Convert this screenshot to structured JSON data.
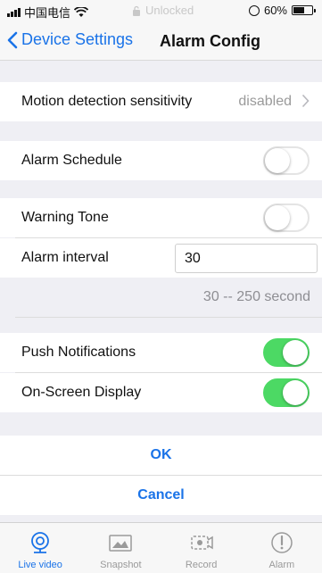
{
  "status_bar": {
    "carrier": "中国电信",
    "center_text": "Unlocked",
    "battery_text": "60%",
    "battery_level": 0.6
  },
  "nav": {
    "back_label": "Device Settings",
    "title": "Alarm Config"
  },
  "settings": {
    "motion": {
      "label": "Motion detection sensitivity",
      "value": "disabled"
    },
    "alarm_schedule": {
      "label": "Alarm Schedule",
      "on": false
    },
    "warning_tone": {
      "label": "Warning Tone",
      "on": false
    },
    "alarm_interval": {
      "label": "Alarm interval",
      "value": "30"
    },
    "interval_hint": "30 -- 250 second",
    "push_notifications": {
      "label": "Push Notifications",
      "on": true
    },
    "osd": {
      "label": "On-Screen Display",
      "on": true
    }
  },
  "buttons": {
    "ok": "OK",
    "cancel": "Cancel"
  },
  "tabs": [
    {
      "label": "Live video",
      "icon": "webcam-icon",
      "active": true
    },
    {
      "label": "Snapshot",
      "icon": "image-icon",
      "active": false
    },
    {
      "label": "Record",
      "icon": "video-record-icon",
      "active": false
    },
    {
      "label": "Alarm",
      "icon": "alert-icon",
      "active": false
    }
  ],
  "colors": {
    "accent": "#1a73e8",
    "toggle_on": "#4cd964",
    "background": "#efeff4"
  }
}
